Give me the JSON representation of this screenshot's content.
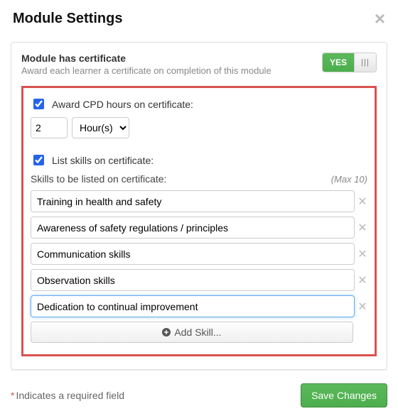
{
  "modal": {
    "title": "Module Settings"
  },
  "certificate": {
    "heading": "Module has certificate",
    "sub": "Award each learner a certificate on completion of this module",
    "toggle_yes": "YES"
  },
  "cpd": {
    "label": "Award CPD hours on certificate:",
    "value": "2",
    "unit": "Hour(s)"
  },
  "skills": {
    "checkbox_label": "List skills on certificate:",
    "list_label": "Skills to be listed on certificate:",
    "max": "(Max 10)",
    "items": [
      "Training in health and safety",
      "Awareness of safety regulations / principles",
      "Communication skills",
      "Observation skills",
      "Dedication to continual improvement"
    ],
    "add_label": "Add Skill..."
  },
  "footer": {
    "required_note": "Indicates a required field",
    "save": "Save Changes"
  }
}
